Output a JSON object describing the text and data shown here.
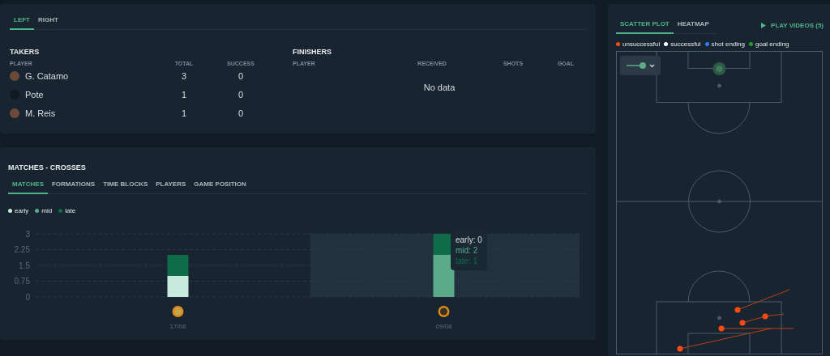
{
  "side_tabs": [
    {
      "label": "LEFT",
      "selected": true
    },
    {
      "label": "RIGHT",
      "selected": false
    }
  ],
  "takers": {
    "title": "TAKERS",
    "columns": [
      "PLAYER",
      "TOTAL",
      "SUCCESS"
    ],
    "rows": [
      {
        "player": "G. Catamo",
        "total": "3",
        "success": "0",
        "has_photo": true
      },
      {
        "player": "Pote",
        "total": "1",
        "success": "0",
        "has_photo": false
      },
      {
        "player": "M. Reis",
        "total": "1",
        "success": "0",
        "has_photo": true
      }
    ]
  },
  "finishers": {
    "title": "FINISHERS",
    "columns": [
      "PLAYER",
      "RECEIVED",
      "SHOTS",
      "GOAL"
    ],
    "empty_text": "No data"
  },
  "matches": {
    "title": "MATCHES - CROSSES",
    "tabs": [
      {
        "label": "MATCHES",
        "selected": true
      },
      {
        "label": "FORMATIONS",
        "selected": false
      },
      {
        "label": "TIME BLOCKS",
        "selected": false
      },
      {
        "label": "PLAYERS",
        "selected": false
      },
      {
        "label": "GAME POSITION",
        "selected": false
      }
    ],
    "chart_data": {
      "type": "bar",
      "stacked": true,
      "grid": true,
      "categories": [
        "17/08",
        "09/08"
      ],
      "yticks": [
        0,
        0.75,
        1.5,
        2.25,
        3
      ],
      "ylim": [
        0,
        3
      ],
      "series": [
        {
          "name": "early",
          "color": "#c8e9dd",
          "values": [
            1,
            0
          ]
        },
        {
          "name": "mid",
          "color": "#5bab8a",
          "values": [
            0,
            2
          ]
        },
        {
          "name": "late",
          "color": "#0f6b48",
          "values": [
            1,
            1
          ]
        }
      ]
    },
    "chart_columns": [
      {
        "hovered": false
      },
      {
        "hovered": true
      }
    ],
    "tooltip": {
      "lines": [
        "early: 0",
        "mid: 2",
        "late: 1"
      ]
    }
  },
  "scatter": {
    "tabs": [
      {
        "label": "SCATTER PLOT",
        "selected": true
      },
      {
        "label": "HEATMAP",
        "selected": false
      }
    ],
    "play_button": "PLAY VIDEOS (5)",
    "legend": [
      {
        "label": "unsuccessful",
        "color": "#ff4a12"
      },
      {
        "label": "successful",
        "color": "#ffffff"
      },
      {
        "label": "shot ending",
        "color": "#2f7cf6"
      },
      {
        "label": "goal ending",
        "color": "#1fa02d"
      }
    ]
  }
}
